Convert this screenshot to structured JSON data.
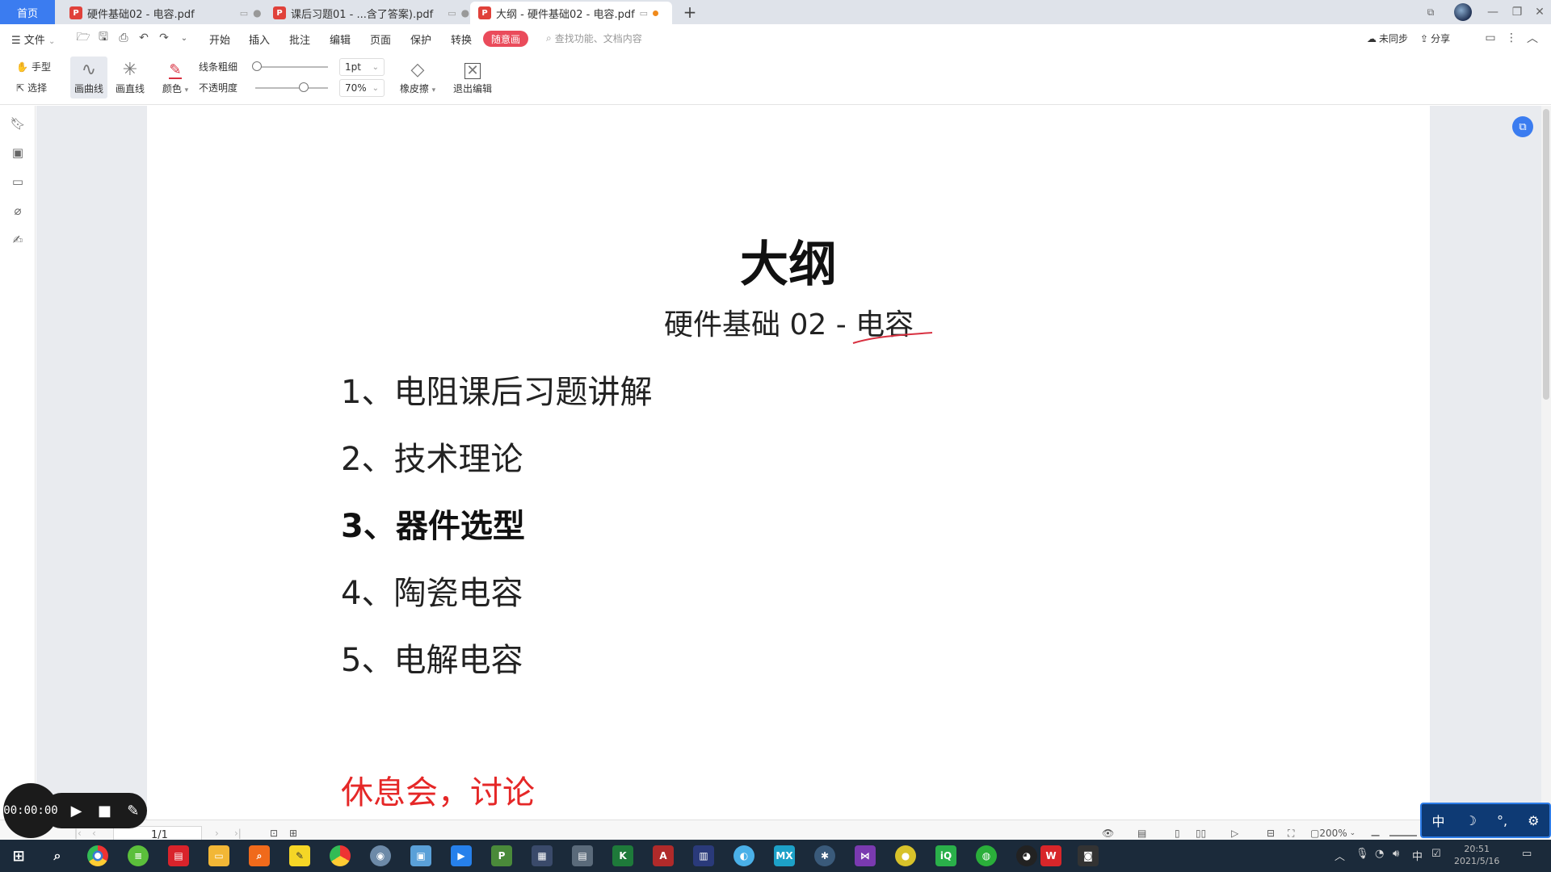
{
  "tabs": {
    "home": "首页",
    "items": [
      {
        "label": "硬件基础02 - 电容.pdf",
        "active": false
      },
      {
        "label": "课后习题01 - ...含了答案).pdf",
        "active": false
      },
      {
        "label": "大纲 - 硬件基础02 - 电容.pdf",
        "active": true
      }
    ]
  },
  "menu": {
    "file": "文件",
    "items": [
      "开始",
      "插入",
      "批注",
      "编辑",
      "页面",
      "保护",
      "转换"
    ],
    "special": "随意画",
    "search_placeholder": "查找功能、文档内容",
    "sync": "未同步",
    "share": "分享"
  },
  "toolbar": {
    "hand": "手型",
    "select": "选择",
    "draw_curve": "画曲线",
    "draw_line": "画直线",
    "color": "颜色",
    "line_width_label": "线条粗细",
    "opacity_label": "不透明度",
    "line_width_value": "1pt",
    "opacity_value": "70%",
    "eraser": "橡皮擦",
    "exit_edit": "退出编辑"
  },
  "document": {
    "title": "大纲",
    "subtitle_prefix": "硬件基础 02 - ",
    "subtitle_highlight": "电容",
    "outline": [
      {
        "text": "1、电阻课后习题讲解",
        "bold": false
      },
      {
        "text": "2、技术理论",
        "bold": false
      },
      {
        "text": "3、器件选型",
        "bold": true
      },
      {
        "text": "4、陶瓷电容",
        "bold": false
      },
      {
        "text": "5、电解电容",
        "bold": false
      }
    ],
    "break_note": "休息会，讨论"
  },
  "status": {
    "page": "1/1",
    "zoom": "200%"
  },
  "recorder": {
    "time": "00:00:00"
  },
  "ime": {
    "lang": "中"
  },
  "taskbar": {
    "time": "20:51",
    "date": "2021/5/16",
    "lang": "中"
  },
  "colors": {
    "accent": "#3b7cf0",
    "special": "#ea4b5b",
    "note_red": "#e52727",
    "annotation_red": "#d83040"
  }
}
